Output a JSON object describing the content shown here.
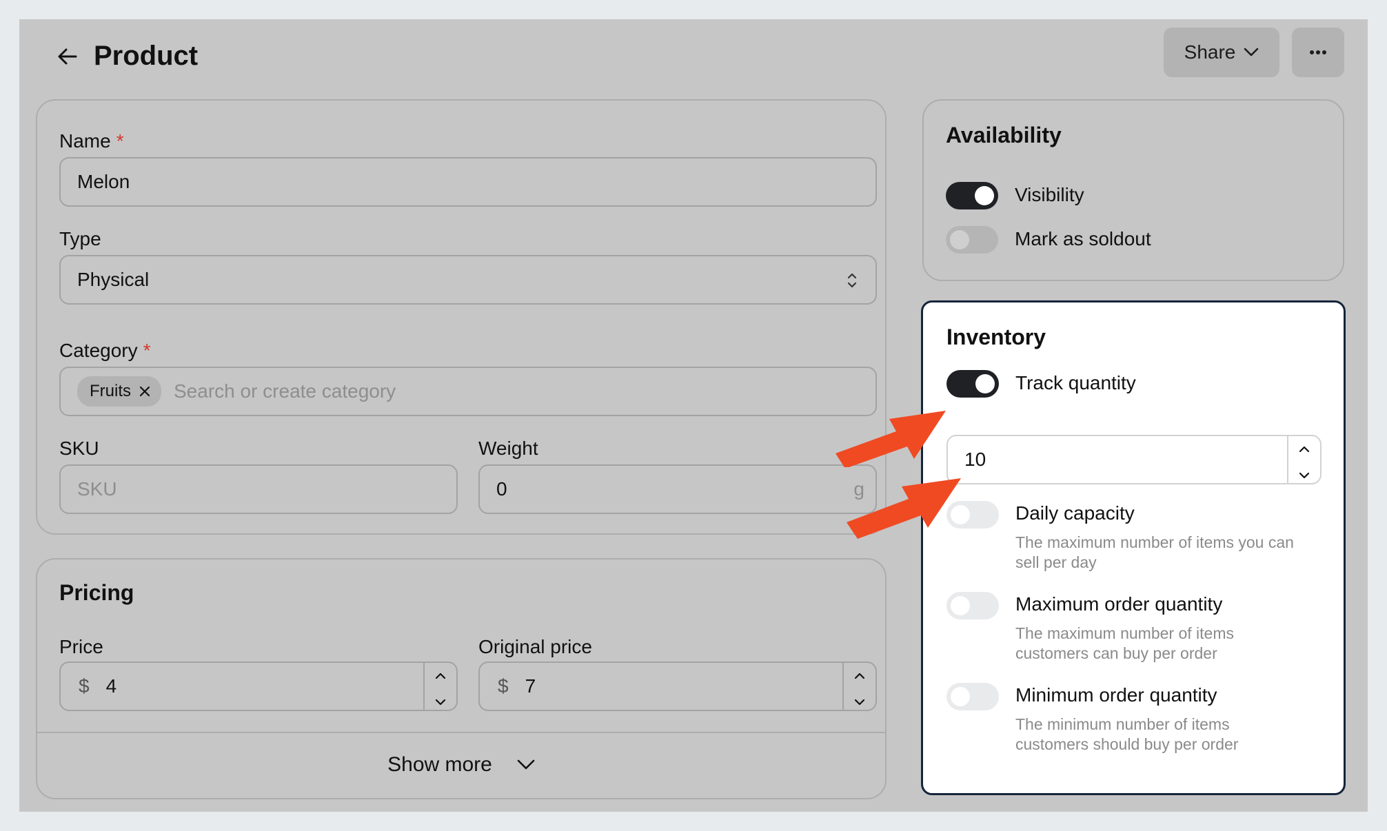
{
  "header": {
    "title": "Product",
    "share_label": "Share",
    "more_label": "⋯"
  },
  "product": {
    "name_label": "Name",
    "name_value": "Melon",
    "type_label": "Type",
    "type_value": "Physical",
    "category_label": "Category",
    "category_chip": "Fruits",
    "category_placeholder": "Search or create category",
    "sku_label": "SKU",
    "sku_placeholder": "SKU",
    "weight_label": "Weight",
    "weight_value": "0",
    "weight_unit": "g",
    "required_marker": "*"
  },
  "pricing": {
    "title": "Pricing",
    "price_label": "Price",
    "price_currency": "$",
    "price_value": "4",
    "original_label": "Original price",
    "original_currency": "$",
    "original_value": "7",
    "show_more": "Show more"
  },
  "availability": {
    "title": "Availability",
    "visibility_label": "Visibility",
    "visibility_on": true,
    "soldout_label": "Mark as soldout",
    "soldout_on": false
  },
  "inventory": {
    "title": "Inventory",
    "track_label": "Track quantity",
    "track_on": true,
    "quantity_value": "10",
    "daily_label": "Daily capacity",
    "daily_desc": "The maximum number of items you can sell per day",
    "daily_on": false,
    "max_label": "Maximum order quantity",
    "max_desc": "The maximum number of items customers can buy per order",
    "max_on": false,
    "min_label": "Minimum order quantity",
    "min_desc": "The minimum number of items customers should buy per order",
    "min_on": false
  },
  "colors": {
    "accent_arrow": "#f04a23",
    "toggle_on": "#1f2124",
    "required": "#d23a2e"
  }
}
